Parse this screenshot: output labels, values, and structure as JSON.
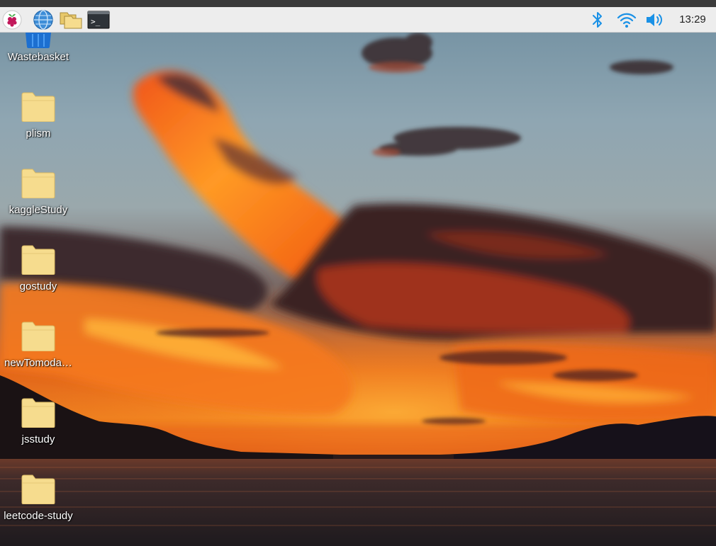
{
  "taskbar": {
    "menu_icon": "raspberry-pi-menu-icon",
    "launchers": [
      {
        "name": "browser",
        "icon": "globe-icon"
      },
      {
        "name": "file-manager",
        "icon": "folders-icon"
      },
      {
        "name": "terminal",
        "icon": "terminal-icon",
        "glyph": ">_"
      }
    ],
    "tray": {
      "bluetooth_icon": "bluetooth-icon",
      "wifi_icon": "wifi-icon",
      "volume_icon": "volume-icon",
      "clock": "13:29"
    },
    "accent_color": "#1a91e6"
  },
  "desktop": {
    "wastebasket": {
      "label": "Wastebasket",
      "icon": "wastebasket-icon"
    },
    "icons": [
      {
        "label": "plism",
        "icon": "folder-icon"
      },
      {
        "label": "kaggleStudy",
        "icon": "folder-icon"
      },
      {
        "label": "gostudy",
        "icon": "folder-icon"
      },
      {
        "label": "newTomodachi",
        "display": "newTomoda…",
        "icon": "folder-icon"
      },
      {
        "label": "jsstudy",
        "icon": "folder-icon"
      },
      {
        "label": "leetcode-study",
        "icon": "folder-icon"
      }
    ],
    "folder_color": "#f6dc8e",
    "wallpaper": "sunset-over-lake-with-orange-clouds"
  }
}
